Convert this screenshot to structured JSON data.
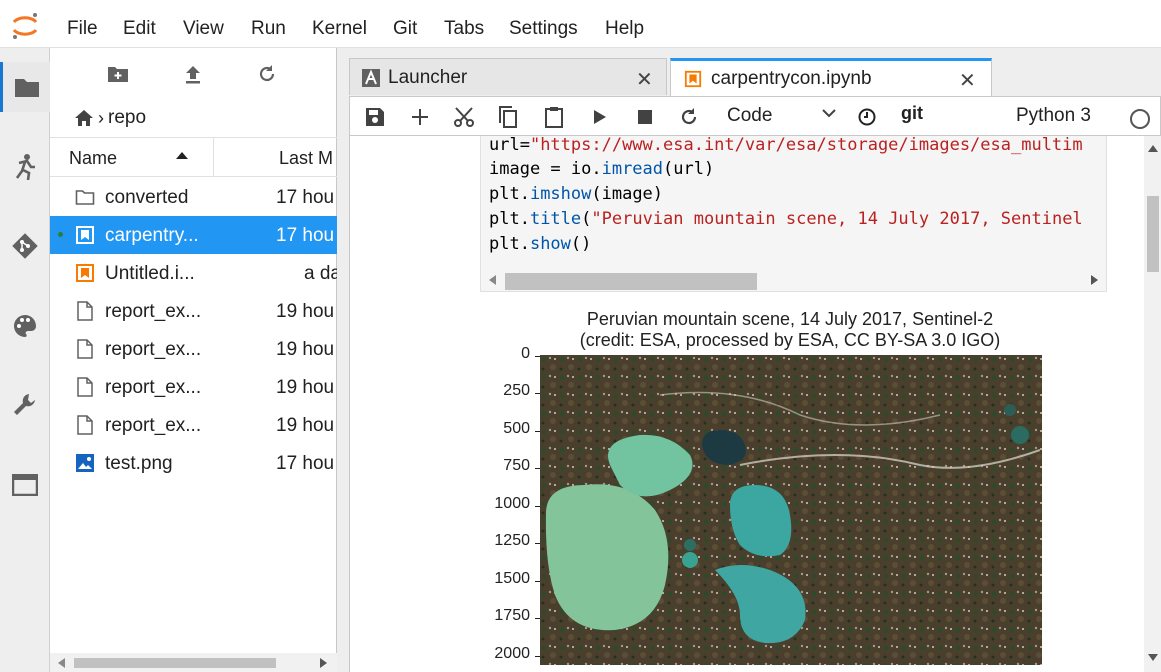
{
  "menu": {
    "items": [
      "File",
      "Edit",
      "View",
      "Run",
      "Kernel",
      "Git",
      "Tabs",
      "Settings",
      "Help"
    ]
  },
  "filebrowser": {
    "breadcrumb": "repo",
    "header": {
      "name": "Name",
      "modified": "Last M"
    },
    "files": [
      {
        "name": "converted",
        "modified": "17 hou",
        "type": "folder"
      },
      {
        "name": "carpentry...",
        "modified": "17 hou",
        "type": "notebook",
        "selected": true
      },
      {
        "name": "Untitled.i...",
        "modified": "a da",
        "type": "notebook"
      },
      {
        "name": "report_ex...",
        "modified": "19 hou",
        "type": "file"
      },
      {
        "name": "report_ex...",
        "modified": "19 hou",
        "type": "file"
      },
      {
        "name": "report_ex...",
        "modified": "19 hou",
        "type": "file"
      },
      {
        "name": "report_ex...",
        "modified": "19 hou",
        "type": "file"
      },
      {
        "name": "test.png",
        "modified": "17 hou",
        "type": "image"
      }
    ]
  },
  "tabs": [
    {
      "label": "Launcher",
      "active": false
    },
    {
      "label": "carpentrycon.ipynb",
      "active": true
    }
  ],
  "notebook": {
    "cell_type": "Code",
    "git_label": "git",
    "kernel": "Python 3",
    "code": {
      "line1_a": "url=",
      "line1_b": "\"https://www.esa.int/var/esa/storage/images/esa_multim",
      "line2_a": "image = io.",
      "line2_b": "imread",
      "line2_c": "(url)",
      "line3_a": "plt.",
      "line3_b": "imshow",
      "line3_c": "(image)",
      "line4_a": "plt.",
      "line4_b": "title",
      "line4_c": "(",
      "line4_d": "\"Peruvian mountain scene, 14 July 2017, Sentinel",
      "line5_a": "plt.",
      "line5_b": "show",
      "line5_c": "()"
    },
    "plot": {
      "title_line1": "Peruvian mountain scene, 14 July 2017, Sentinel-2",
      "title_line2": "(credit: ESA, processed by ESA, CC BY-SA 3.0 IGO)",
      "yticks": [
        "0",
        "250",
        "500",
        "750",
        "1000",
        "1250",
        "1500",
        "1750",
        "2000"
      ]
    }
  },
  "colors": {
    "accent": "#2196f3",
    "notebook_orange": "#f57c00",
    "image_blue": "#1565c0"
  }
}
